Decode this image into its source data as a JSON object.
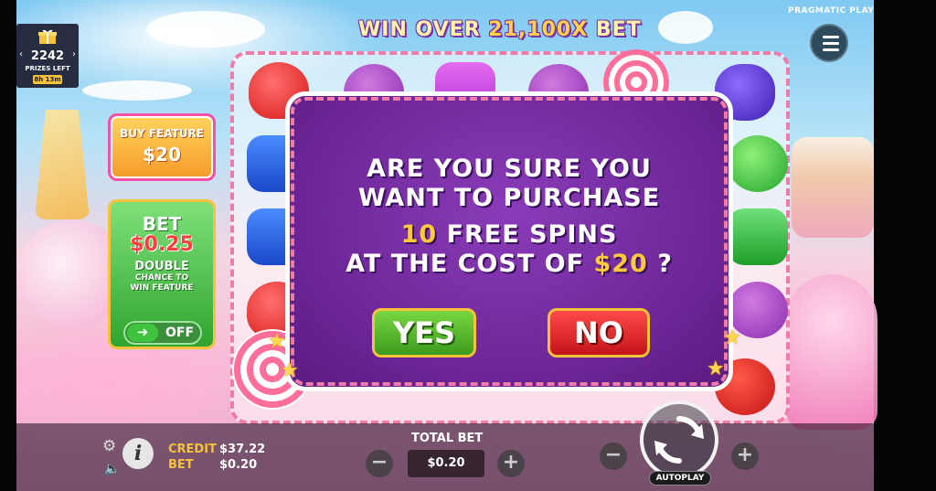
{
  "banner": {
    "prefix": "WIN OVER ",
    "amount": "21,100X",
    "suffix": " BET"
  },
  "brand": "PRAGMATIC PLAY",
  "prize_widget": {
    "count": "2242",
    "label": "PRIZES LEFT",
    "timer": "8h 13m"
  },
  "buy_feature": {
    "label": "BUY FEATURE",
    "price": "$20"
  },
  "bet_panel": {
    "label": "BET",
    "amount": "$0.25",
    "double": "DOUBLE",
    "chance_line1": "CHANCE TO",
    "chance_line2": "WIN FEATURE",
    "toggle_state": "OFF"
  },
  "dialog": {
    "line1": "ARE YOU SURE YOU",
    "line2": "WANT TO PURCHASE",
    "spins_count": "10",
    "spins_text": " FREE SPINS",
    "cost_prefix": "AT THE COST OF ",
    "cost_amount": "$20",
    "cost_suffix": " ?",
    "yes_label": "YES",
    "no_label": "NO"
  },
  "bottom": {
    "credit_label": "CREDIT",
    "credit_value": "$37.22",
    "bet_label": "BET",
    "bet_value": "$0.20",
    "total_bet_label": "TOTAL BET",
    "total_bet_value": "$0.20",
    "autoplay_label": "AUTOPLAY"
  },
  "colors": {
    "dialog_bg": "#6a2494",
    "yes": "#3c9b1e",
    "no": "#c4141a",
    "gold": "#ffc93c",
    "accent_pink": "#f07aa8"
  },
  "icons": [
    "gift-icon",
    "menu-icon",
    "gear-icon",
    "speaker-icon",
    "info-icon",
    "minus-icon",
    "plus-icon",
    "spin-icon",
    "arrow-right-icon",
    "star-icon"
  ]
}
